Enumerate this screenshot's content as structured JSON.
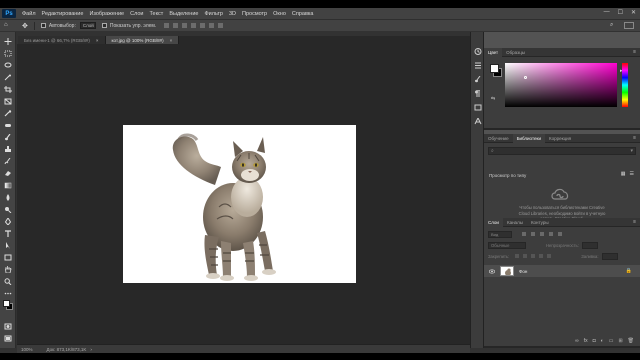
{
  "app": {
    "logo": "Ps",
    "menu": [
      "Файл",
      "Редактирование",
      "Изображение",
      "Слои",
      "Текст",
      "Выделение",
      "Фильтр",
      "3D",
      "Просмотр",
      "Окно",
      "Справка"
    ],
    "window_controls": [
      "—",
      "☐",
      "✕"
    ]
  },
  "options": {
    "autoselect_label": "Автовыбор:",
    "autoselect_value": "Слой",
    "transform_label": "Показать упр. элем."
  },
  "tabs": [
    {
      "label": "Без имени-1 @ 66,7% (RGB/8#)",
      "close": "×"
    },
    {
      "label": "кот.jpg @ 100% (RGB/8#)",
      "close": "×"
    }
  ],
  "tools": [
    "move-tool",
    "marquee-tool",
    "lasso-tool",
    "magic-wand-tool",
    "crop-tool",
    "frame-tool",
    "eyedropper-tool",
    "healing-tool",
    "brush-tool",
    "stamp-tool",
    "history-brush-tool",
    "eraser-tool",
    "gradient-tool",
    "blur-tool",
    "dodge-tool",
    "pen-tool",
    "type-tool",
    "path-select-tool",
    "rectangle-tool",
    "hand-tool",
    "zoom-tool",
    "more-tools"
  ],
  "status": {
    "zoom": "100%",
    "doc": "Док: 873,1K/873,1K",
    "arrow": "›"
  },
  "color_panel": {
    "tabs": [
      "Цвет",
      "Образцы"
    ],
    "active_tab": 0,
    "accent": "#ff00d0"
  },
  "library_panel": {
    "tabs": [
      "Обучение",
      "Библиотеки",
      "Коррекция"
    ],
    "active_tab": 1,
    "search_placeholder": "",
    "view_label": "Просмотр по типу",
    "message": "Чтобы пользоваться библиотеками Creative Cloud Libraries, необходимо войти в учетную запись Creative Cloud."
  },
  "layers_panel": {
    "tabs": [
      "Слои",
      "Каналы",
      "Контуры"
    ],
    "active_tab": 0,
    "kind_label": "Вид",
    "mode": "Обычные",
    "opacity_label": "Непрозрачность:",
    "lock_label": "Закрепить:",
    "fill_label": "Заливка:",
    "layer_name": "Фон"
  }
}
